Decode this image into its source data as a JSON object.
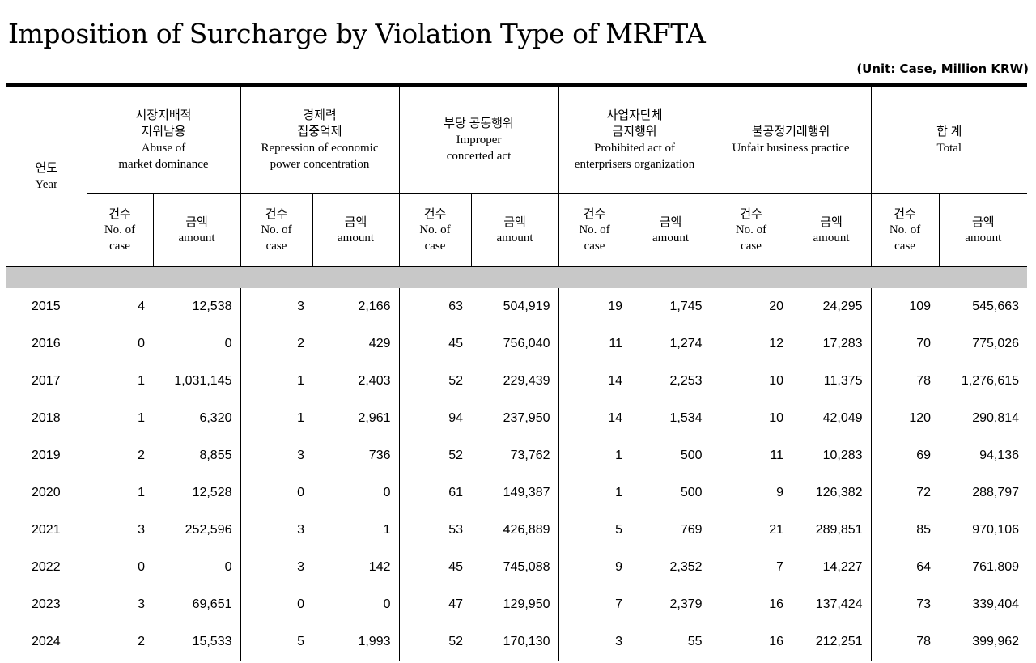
{
  "title": "Imposition of Surcharge by Violation Type of MRFTA",
  "unit": "(Unit: Case, Million KRW)",
  "header": {
    "year_kr": "연도",
    "year_en": "Year",
    "groups": [
      {
        "kr1": "시장지배적",
        "kr2": "지위남용",
        "en1": "Abuse of",
        "en2": "market dominance"
      },
      {
        "kr1": "경제력",
        "kr2": "집중억제",
        "en1": "Repression of economic",
        "en2": "power concentration"
      },
      {
        "kr1": "부당 공동행위",
        "kr2": "",
        "en1": "Improper",
        "en2": "concerted act"
      },
      {
        "kr1": "사업자단체",
        "kr2": "금지행위",
        "en1": "Prohibited act of",
        "en2": "enterprisers organization"
      },
      {
        "kr1": "불공정거래행위",
        "kr2": "",
        "en1": "Unfair business practice",
        "en2": ""
      },
      {
        "kr1": "합 계",
        "kr2": "",
        "en1": "Total",
        "en2": ""
      }
    ],
    "sub": {
      "case_kr": "건수",
      "case_en1": "No. of",
      "case_en2": "case",
      "amount_kr": "금액",
      "amount_en": "amount"
    }
  },
  "rows": [
    [
      "2015",
      "4",
      "12,538",
      "3",
      "2,166",
      "63",
      "504,919",
      "19",
      "1,745",
      "20",
      "24,295",
      "109",
      "545,663"
    ],
    [
      "2016",
      "0",
      "0",
      "2",
      "429",
      "45",
      "756,040",
      "11",
      "1,274",
      "12",
      "17,283",
      "70",
      "775,026"
    ],
    [
      "2017",
      "1",
      "1,031,145",
      "1",
      "2,403",
      "52",
      "229,439",
      "14",
      "2,253",
      "10",
      "11,375",
      "78",
      "1,276,615"
    ],
    [
      "2018",
      "1",
      "6,320",
      "1",
      "2,961",
      "94",
      "237,950",
      "14",
      "1,534",
      "10",
      "42,049",
      "120",
      "290,814"
    ],
    [
      "2019",
      "2",
      "8,855",
      "3",
      "736",
      "52",
      "73,762",
      "1",
      "500",
      "11",
      "10,283",
      "69",
      "94,136"
    ],
    [
      "2020",
      "1",
      "12,528",
      "0",
      "0",
      "61",
      "149,387",
      "1",
      "500",
      "9",
      "126,382",
      "72",
      "288,797"
    ],
    [
      "2021",
      "3",
      "252,596",
      "3",
      "1",
      "53",
      "426,889",
      "5",
      "769",
      "21",
      "289,851",
      "85",
      "970,106"
    ],
    [
      "2022",
      "0",
      "0",
      "3",
      "142",
      "45",
      "745,088",
      "9",
      "2,352",
      "7",
      "14,227",
      "64",
      "761,809"
    ],
    [
      "2023",
      "3",
      "69,651",
      "0",
      "0",
      "47",
      "129,950",
      "7",
      "2,379",
      "16",
      "137,424",
      "73",
      "339,404"
    ],
    [
      "2024",
      "2",
      "15,533",
      "5",
      "1,993",
      "52",
      "170,130",
      "3",
      "55",
      "16",
      "212,251",
      "78",
      "399,962"
    ]
  ]
}
